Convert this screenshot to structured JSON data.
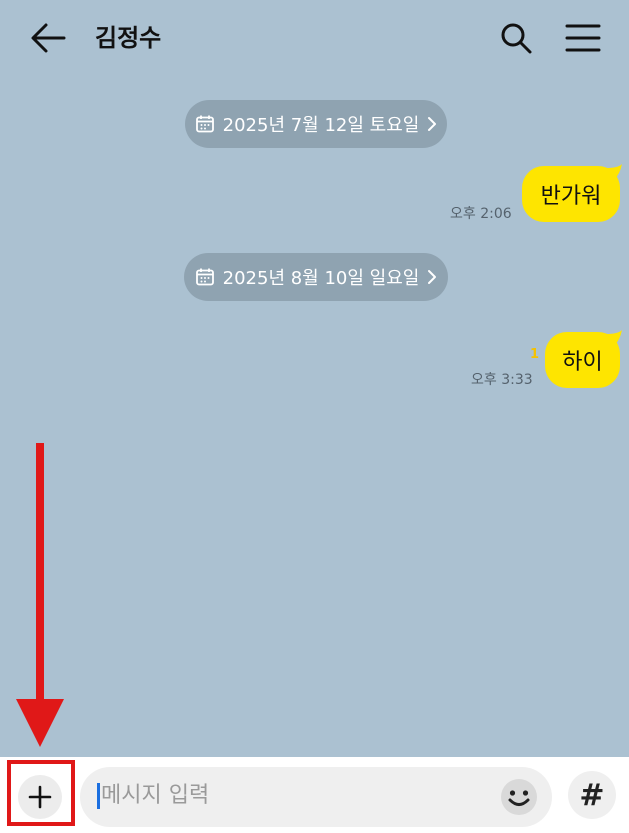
{
  "header": {
    "title": "김정수",
    "back_icon": "arrow-left-icon",
    "search_icon": "search-icon",
    "menu_icon": "hamburger-menu-icon"
  },
  "date_dividers": [
    {
      "label": "2025년 7월 12일 토요일"
    },
    {
      "label": "2025년 8월 10일 일요일"
    }
  ],
  "messages": [
    {
      "text": "반가워",
      "time": "오후 2:06",
      "unread": ""
    },
    {
      "text": "하이",
      "time": "오후 3:33",
      "unread": "1"
    }
  ],
  "input": {
    "placeholder": "메시지 입력",
    "plus_icon": "plus-icon",
    "emoji_icon": "emoji-icon",
    "hashtag_icon": "hashtag-icon",
    "hashtag_label": "#"
  },
  "colors": {
    "chat_background": "#abc1d1",
    "bubble": "#fee500",
    "date_pill": "#8fa3b1",
    "unread": "#f5c200",
    "annotation": "#e01818"
  }
}
